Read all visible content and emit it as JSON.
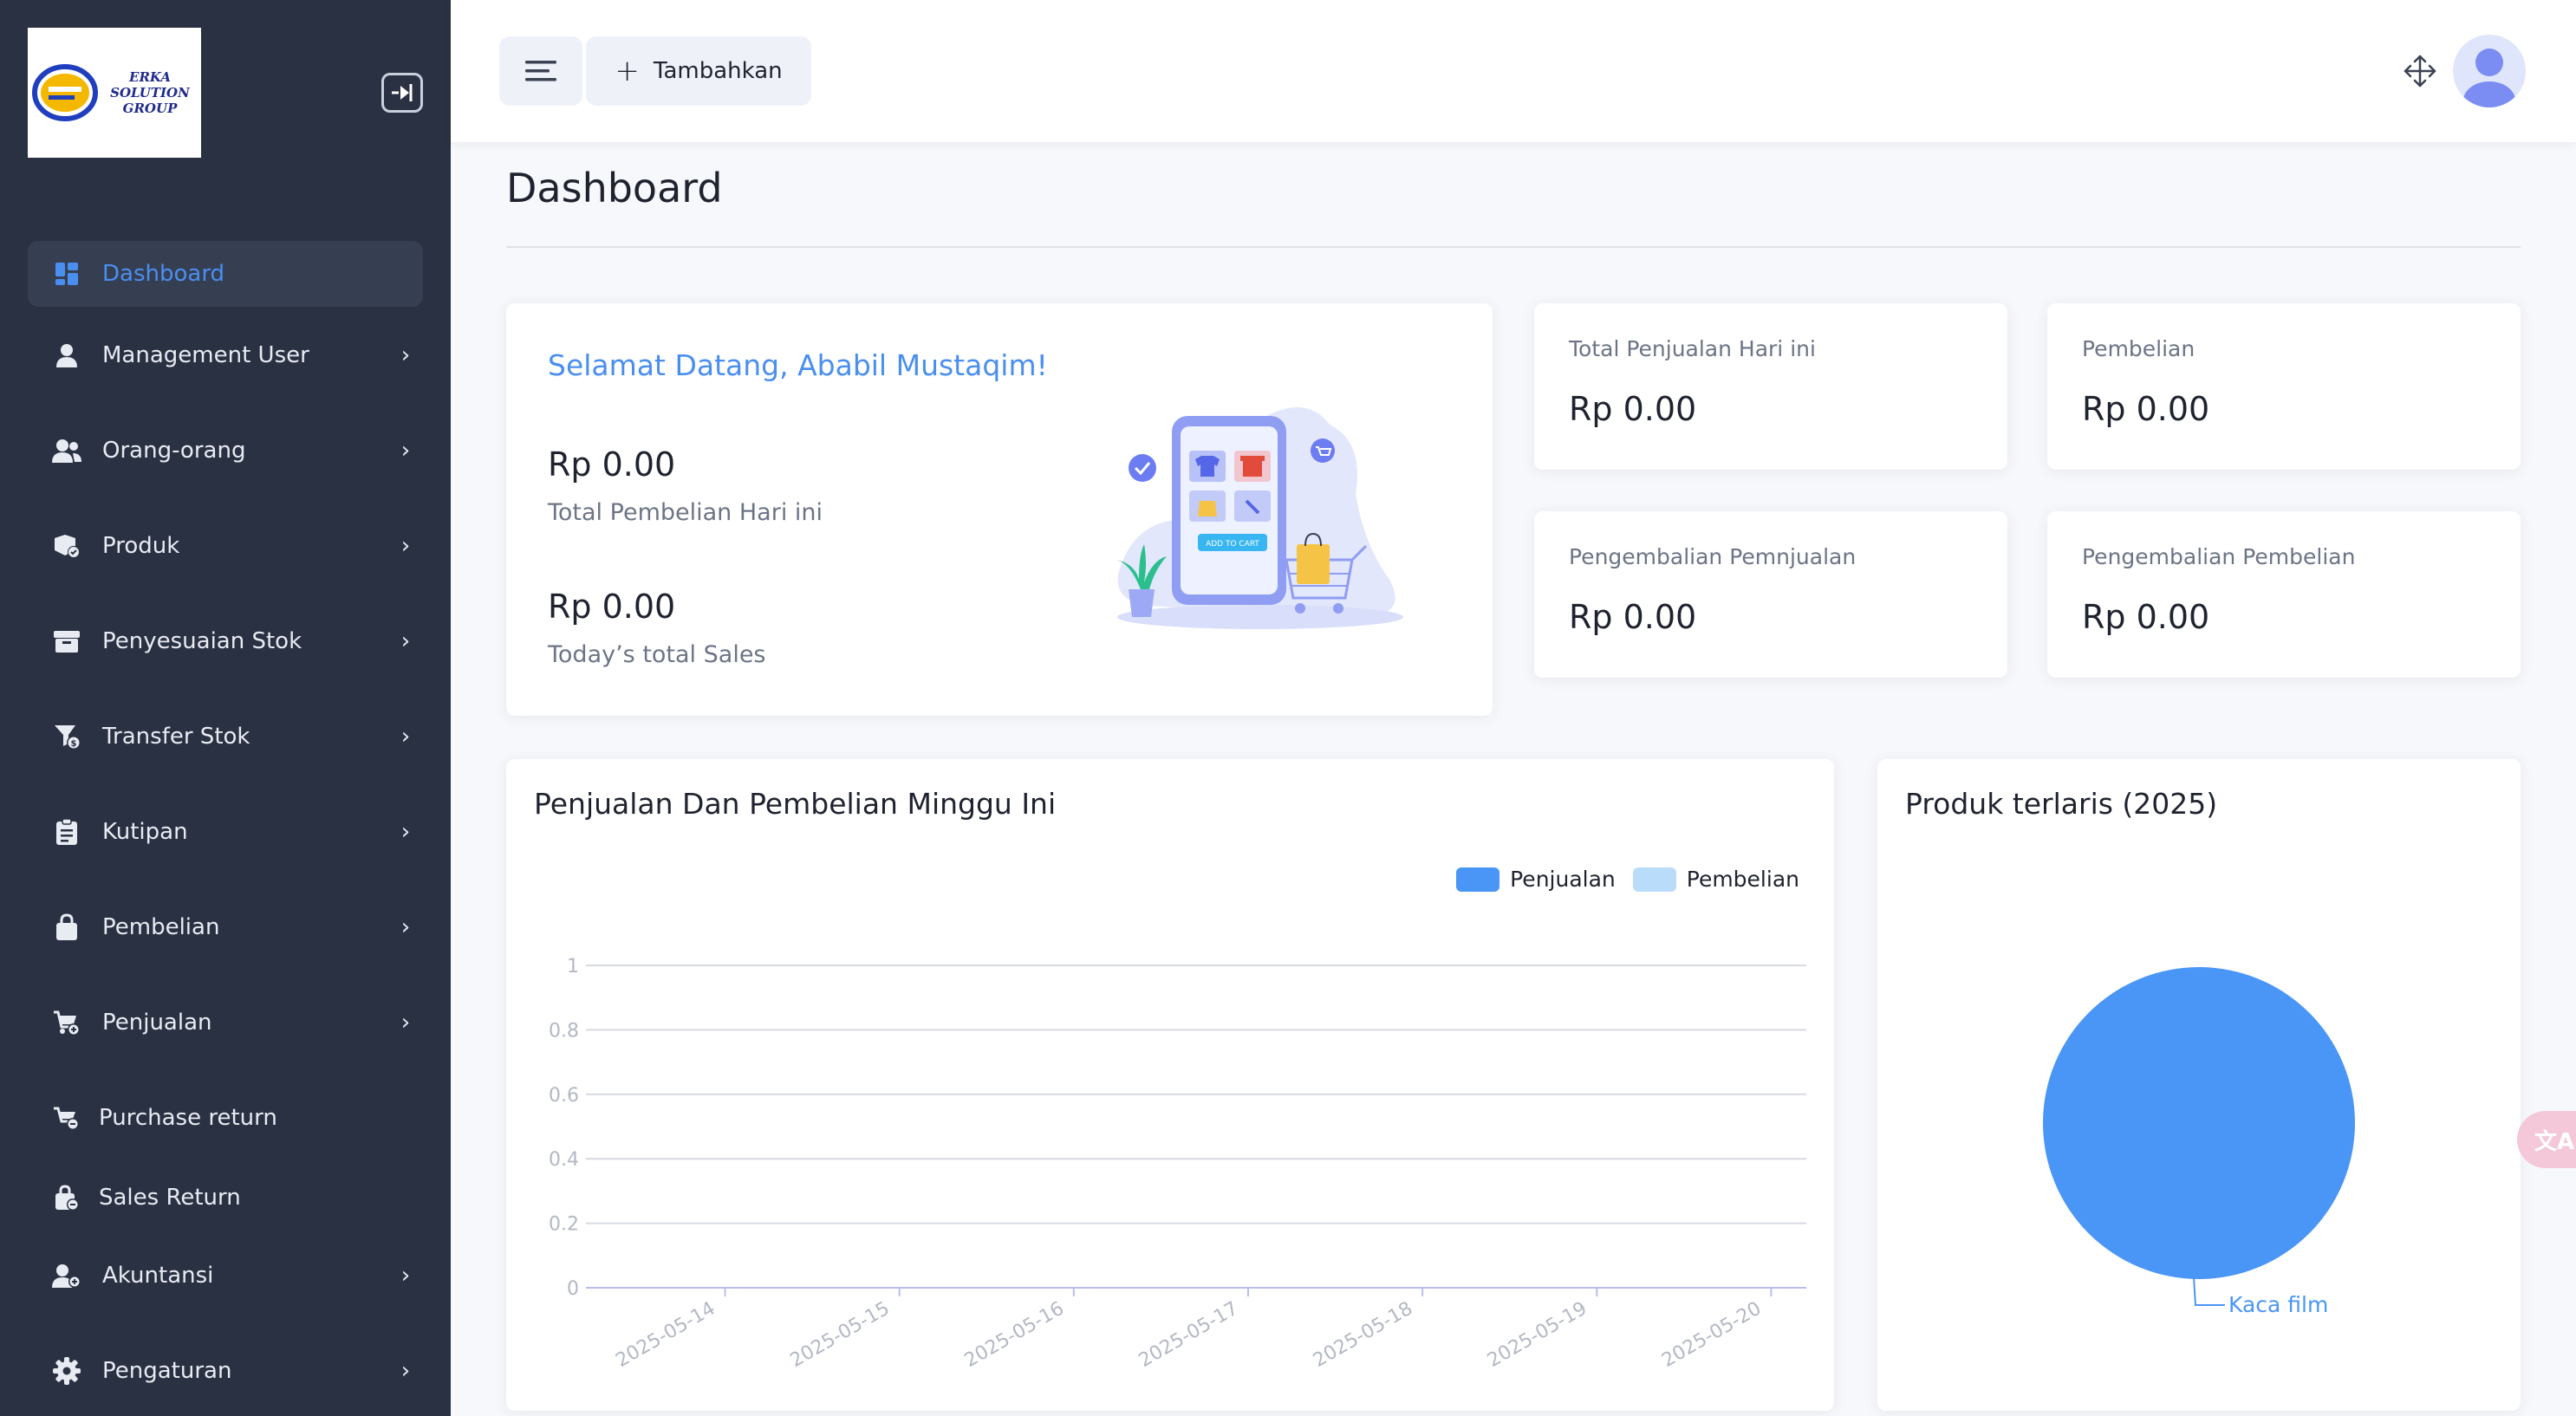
{
  "logo": {
    "text": "ERKA SOLUTION\nGROUP"
  },
  "sidebar": {
    "items": [
      {
        "label": "Dashboard",
        "icon": "dashboard-icon",
        "active": true,
        "chevron": false
      },
      {
        "label": "Management User",
        "icon": "user-icon",
        "chevron": true
      },
      {
        "label": "Orang-orang",
        "icon": "people-icon",
        "chevron": true
      },
      {
        "label": "Produk",
        "icon": "product-icon",
        "chevron": true
      },
      {
        "label": "Penyesuaian Stok",
        "icon": "stock-adjust-icon",
        "chevron": true
      },
      {
        "label": "Transfer Stok",
        "icon": "transfer-icon",
        "chevron": true
      },
      {
        "label": "Kutipan",
        "icon": "quotation-icon",
        "chevron": true
      },
      {
        "label": "Pembelian",
        "icon": "purchase-bag-icon",
        "chevron": true
      },
      {
        "label": "Penjualan",
        "icon": "sales-cart-icon",
        "chevron": true
      },
      {
        "label": "Purchase return",
        "icon": "purchase-return-icon",
        "chevron": false
      },
      {
        "label": "Sales Return",
        "icon": "sales-return-icon",
        "chevron": false
      },
      {
        "label": "Akuntansi",
        "icon": "accounting-icon",
        "chevron": true
      },
      {
        "label": "Pengaturan",
        "icon": "settings-gear-icon",
        "chevron": true
      }
    ],
    "chevron_glyph": "›"
  },
  "topbar": {
    "add_label": "Tambahkan"
  },
  "page": {
    "title": "Dashboard"
  },
  "welcome": {
    "title": "Selamat Datang, Ababil Mustaqim!",
    "purchase_amount": "Rp 0.00",
    "purchase_label": "Total Pembelian Hari ini",
    "sales_amount": "Rp 0.00",
    "sales_label": "Today’s total Sales",
    "illustration_button": "ADD TO CART"
  },
  "stats": [
    {
      "label": "Total Penjualan Hari ini",
      "value": "Rp 0.00"
    },
    {
      "label": "Pembelian",
      "value": "Rp 0.00"
    },
    {
      "label": "Pengembalian Pemnjualan",
      "value": "Rp 0.00"
    },
    {
      "label": "Pengembalian Pembelian",
      "value": "Rp 0.00"
    }
  ],
  "weekly_chart": {
    "title": "Penjualan Dan Pembelian Minggu Ini",
    "legend": [
      {
        "name": "Penjualan",
        "color": "#4a96f6"
      },
      {
        "name": "Pembelian",
        "color": "#b9dcfb"
      }
    ]
  },
  "pie_chart": {
    "title": "Produk terlaris (2025)",
    "color": "#4a96f6"
  },
  "translate_badge": "文A",
  "chart_data": [
    {
      "type": "bar",
      "title": "Penjualan Dan Pembelian Minggu Ini",
      "categories": [
        "2025-05-14",
        "2025-05-15",
        "2025-05-16",
        "2025-05-17",
        "2025-05-18",
        "2025-05-19",
        "2025-05-20"
      ],
      "series": [
        {
          "name": "Penjualan",
          "values": [
            0,
            0,
            0,
            0,
            0,
            0,
            0
          ]
        },
        {
          "name": "Pembelian",
          "values": [
            0,
            0,
            0,
            0,
            0,
            0,
            0
          ]
        }
      ],
      "yticks": [
        "0",
        "0.2",
        "0.4",
        "0.6",
        "0.8",
        "1"
      ],
      "ylim": [
        0,
        1
      ],
      "grid": true,
      "legend": "top-right"
    },
    {
      "type": "pie",
      "title": "Produk terlaris (2025)",
      "labels": [
        "Kaca film"
      ],
      "values": [
        1
      ]
    }
  ]
}
